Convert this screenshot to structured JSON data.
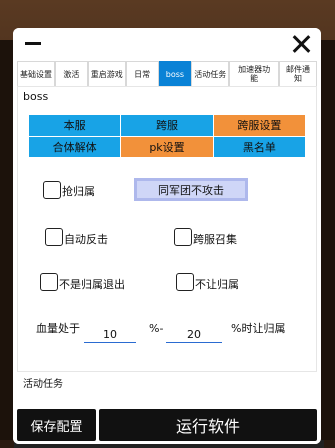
{
  "tabs": [
    {
      "label": "基础设置"
    },
    {
      "label": "激活"
    },
    {
      "label": "重启游戏"
    },
    {
      "label": "日常"
    },
    {
      "label": "boss"
    },
    {
      "label": "活动任务"
    },
    {
      "label": "加速器功\n能"
    },
    {
      "label": "邮件通\n知"
    }
  ],
  "active_tab": "boss",
  "section": {
    "title": "boss"
  },
  "server_buttons": [
    {
      "label": "本服",
      "color": "#18a3e6"
    },
    {
      "label": "跨服",
      "color": "#18a3e6"
    },
    {
      "label": "跨服设置",
      "color": "#f2913a"
    },
    {
      "label": "合体解体",
      "color": "#18a3e6"
    },
    {
      "label": "pk设置",
      "color": "#f2913a"
    },
    {
      "label": "黑名单",
      "color": "#18a3e6"
    }
  ],
  "options": {
    "grab_ownership": {
      "label": "抢归属",
      "checked": false
    },
    "same_army_no_attack": {
      "label": "同军团不攻击"
    },
    "auto_counter": {
      "label": "自动反击",
      "checked": false
    },
    "cross_server_summon": {
      "label": "跨服召集",
      "checked": false
    },
    "exit_if_not_owner": {
      "label": "不是归属退出",
      "checked": false
    },
    "disallow_ownership": {
      "label": "不让归属",
      "checked": false
    }
  },
  "hp": {
    "prefix": "血量处于",
    "min_value": "10",
    "separator": "%-",
    "max_value": "20",
    "suffix": "%时让归属"
  },
  "activity": {
    "title": "活动任务"
  },
  "actions": {
    "save_label": "保存配置",
    "run_label": "运行软件"
  },
  "colors": {
    "accent_blue": "#0a82d6",
    "button_blue": "#18a3e6",
    "button_orange": "#f2913a",
    "dark": "#111111"
  }
}
